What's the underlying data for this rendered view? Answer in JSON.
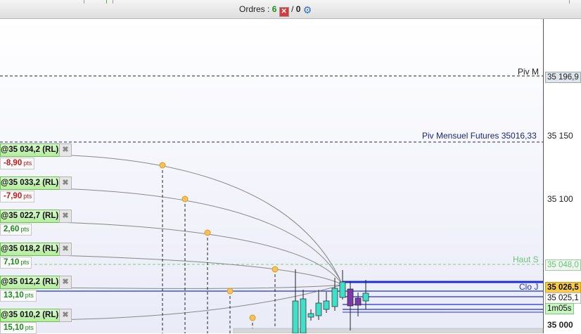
{
  "toolbar": {
    "orders_label": "Ordres :",
    "orders_count": "6",
    "separator": "/",
    "orders_count_2": "0"
  },
  "axis": {
    "labels": [
      "35 150",
      "35 100",
      "35 000"
    ]
  },
  "price_tags": {
    "piv_m": "35 196,9",
    "haut_s": "35 048,0",
    "clo_j": "35 026,5",
    "last": "35 025,1",
    "timer": "1m05s"
  },
  "lines": {
    "piv_m_label": "Piv M",
    "piv_mensuel_label": "Piv Mensuel Futures 35016,33",
    "haut_s_label": "Haut S",
    "clo_j_label": "Clo J"
  },
  "orders": [
    {
      "price": "@35 034,2",
      "type": "(RL)",
      "pts": "-8,90",
      "unit": "pts",
      "sign": "neg"
    },
    {
      "price": "@35 033,2",
      "type": "(RL)",
      "pts": "-7,90",
      "unit": "pts",
      "sign": "neg"
    },
    {
      "price": "@35 022,7",
      "type": "(RL)",
      "pts": "2,60",
      "unit": "pts",
      "sign": "pos"
    },
    {
      "price": "@35 018,2",
      "type": "(RL)",
      "pts": "7,10",
      "unit": "pts",
      "sign": "pos"
    },
    {
      "price": "@35 012,2",
      "type": "(RL)",
      "pts": "13,10",
      "unit": "pts",
      "sign": "pos"
    },
    {
      "price": "@35 010,2",
      "type": "(RL)",
      "pts": "15,10",
      "unit": "pts",
      "sign": "pos"
    }
  ],
  "colors": {
    "order_green": "#b5ec9f",
    "negative": "#c31818",
    "positive": "#1a8a1a",
    "candle_up": "#40e0c8",
    "candle_down": "#7b3aa8",
    "clo_line": "#1f2fd8",
    "haut_line": "#7fcf8a"
  },
  "icons": {
    "cancel": "close-icon",
    "settings": "gear-icon"
  }
}
